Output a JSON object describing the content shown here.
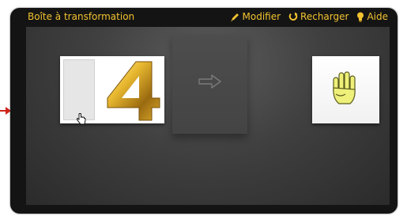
{
  "header": {
    "title": "Boîte à transformation",
    "actions": {
      "edit_label": "Modifier",
      "reload_label": "Recharger",
      "help_label": "Aide"
    }
  },
  "colors": {
    "accent": "#f2c230",
    "frame": "#141414",
    "stage": "#404040"
  },
  "workspace": {
    "input_card": {
      "blank_slot": "empty-slot",
      "digit": "4"
    },
    "transform_icon": "arrow-right-icon",
    "output_card": {
      "image": "hand-four-fingers-icon"
    }
  }
}
